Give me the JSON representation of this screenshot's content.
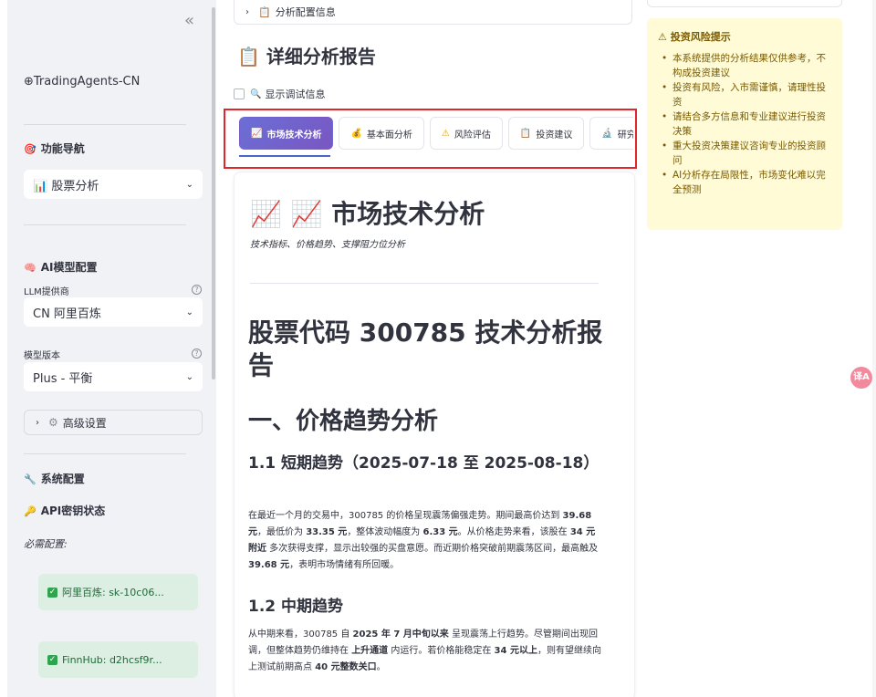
{
  "sidebar": {
    "collapse": "«",
    "brand": "⊕TradingAgents-CN",
    "nav_title": "功能导航",
    "nav_icon": "🎯",
    "nav_select": "股票分析",
    "nav_select_icon": "📊",
    "ai_title": "AI模型配置",
    "ai_icon": "🧠",
    "llm_label": "LLM提供商",
    "llm_value": "CN 阿里百炼",
    "model_label": "模型版本",
    "model_value": "Plus - 平衡",
    "help_glyph": "?",
    "advanced_label": "高级设置",
    "advanced_icon": "⚙",
    "sys_title": "系统配置",
    "sys_icon": "🔧",
    "api_title": "API密钥状态",
    "api_icon": "🔑",
    "required_note": "必需配置:",
    "keys": [
      {
        "label": "阿里百炼: sk-10c06..."
      },
      {
        "label": "FinnHub: d2hcsf9r..."
      }
    ]
  },
  "main": {
    "top_expander": "分析配置信息",
    "report_title": "详细分析报告",
    "report_icon": "📋",
    "debug_label": "显示调试信息",
    "debug_icon": "🔍",
    "tabs": [
      {
        "icon": "📈",
        "label": "市场技术分析"
      },
      {
        "icon": "💰",
        "label": "基本面分析"
      },
      {
        "icon": "⚠",
        "label": "风险评估"
      },
      {
        "icon": "📋",
        "label": "投资建议"
      },
      {
        "icon": "🔬",
        "label": "研究团"
      }
    ],
    "card": {
      "heading": "📈 📈 市场技术分析",
      "subtitle": "技术指标、价格趋势、支撑阻力位分析",
      "h1": "股票代码 300785 技术分析报告",
      "h2": "一、价格趋势分析",
      "h3a": "1.1 短期趋势（2025-07-18 至 2025-08-18）",
      "para_a": [
        {
          "t": "在最近一个月的交易中，300785 的价格呈现震荡偏强走势。期间最高价达到 ",
          "b": false
        },
        {
          "t": "39.68 元",
          "b": true
        },
        {
          "t": "，最低价为 ",
          "b": false
        },
        {
          "t": "33.35 元",
          "b": true
        },
        {
          "t": "，整体波动幅度为 ",
          "b": false
        },
        {
          "t": "6.33 元",
          "b": true
        },
        {
          "t": "。从价格走势来看，该股在 ",
          "b": false
        },
        {
          "t": "34 元附近",
          "b": true
        },
        {
          "t": " 多次获得支撑，显示出较强的买盘意愿。而近期价格突破前期震荡区间，最高触及 ",
          "b": false
        },
        {
          "t": "39.68 元",
          "b": true
        },
        {
          "t": "，表明市场情绪有所回暖。",
          "b": false
        }
      ],
      "h3b": "1.2 中期趋势",
      "para_b": [
        {
          "t": "从中期来看，300785 自 ",
          "b": false
        },
        {
          "t": "2025 年 7 月中旬以来",
          "b": true
        },
        {
          "t": " 呈现震荡上行趋势。尽管期间出现回调，但整体趋势仍维持在 ",
          "b": false
        },
        {
          "t": "上升通道",
          "b": true
        },
        {
          "t": " 内运行。若价格能稳定在 ",
          "b": false
        },
        {
          "t": "34 元以上",
          "b": true
        },
        {
          "t": "，则有望继续向上测试前期高点 ",
          "b": false
        },
        {
          "t": "40 元整数关口",
          "b": true
        },
        {
          "t": "。",
          "b": false
        }
      ]
    }
  },
  "right": {
    "risk_title": "⚠ 投资风险提示",
    "risk_items": [
      "本系统提供的分析结果仅供参考，不构成投资建议",
      "投资有风险，入市需谨慎，请理性投资",
      "请结合多方信息和专业建议进行投资决策",
      "重大投资决策建议咨询专业的投资顾问",
      "AI分析存在局限性，市场变化难以完全预测"
    ]
  },
  "floating": {
    "translate": "译A"
  },
  "colors": {
    "accent": "#6a6fd6",
    "highlight": "#e0262b",
    "warning_bg": "#fffbd6",
    "success_bg": "#dcefe2"
  }
}
